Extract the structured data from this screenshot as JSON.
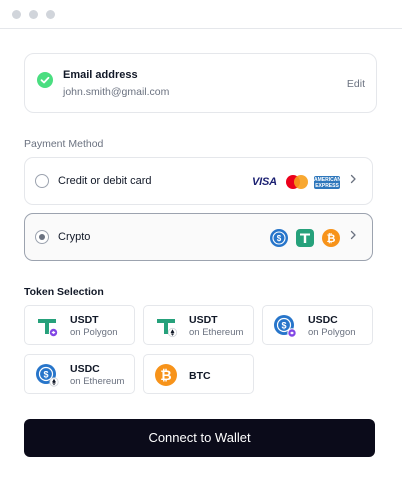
{
  "email": {
    "label": "Email address",
    "value": "john.smith@gmail.com",
    "edit_label": "Edit"
  },
  "payment": {
    "title": "Payment Method",
    "options": [
      {
        "label": "Credit or debit card",
        "selected": false,
        "logos": [
          "visa",
          "mastercard",
          "amex"
        ],
        "visa_text": "VISA",
        "amex_text": "AMERICAN EXPRESS"
      },
      {
        "label": "Crypto",
        "selected": true,
        "logos": [
          "usdc",
          "usdt",
          "btc"
        ]
      }
    ]
  },
  "tokens": {
    "title": "Token Selection",
    "items": [
      {
        "name": "USDT",
        "network": "on Polygon",
        "icon": "usdt-polygon-icon"
      },
      {
        "name": "USDT",
        "network": "on Ethereum",
        "icon": "usdt-ethereum-icon"
      },
      {
        "name": "USDC",
        "network": "on Polygon",
        "icon": "usdc-polygon-icon"
      },
      {
        "name": "USDC",
        "network": "on Ethereum",
        "icon": "usdc-ethereum-icon"
      },
      {
        "name": "BTC",
        "icon": "btc-icon"
      }
    ]
  },
  "connect_label": "Connect to Wallet",
  "colors": {
    "usdt": "#26a17b",
    "usdc": "#2775ca",
    "btc": "#f7931a",
    "polygon": "#8247e5",
    "check": "#4ade80",
    "button": "#0b0b1a"
  }
}
